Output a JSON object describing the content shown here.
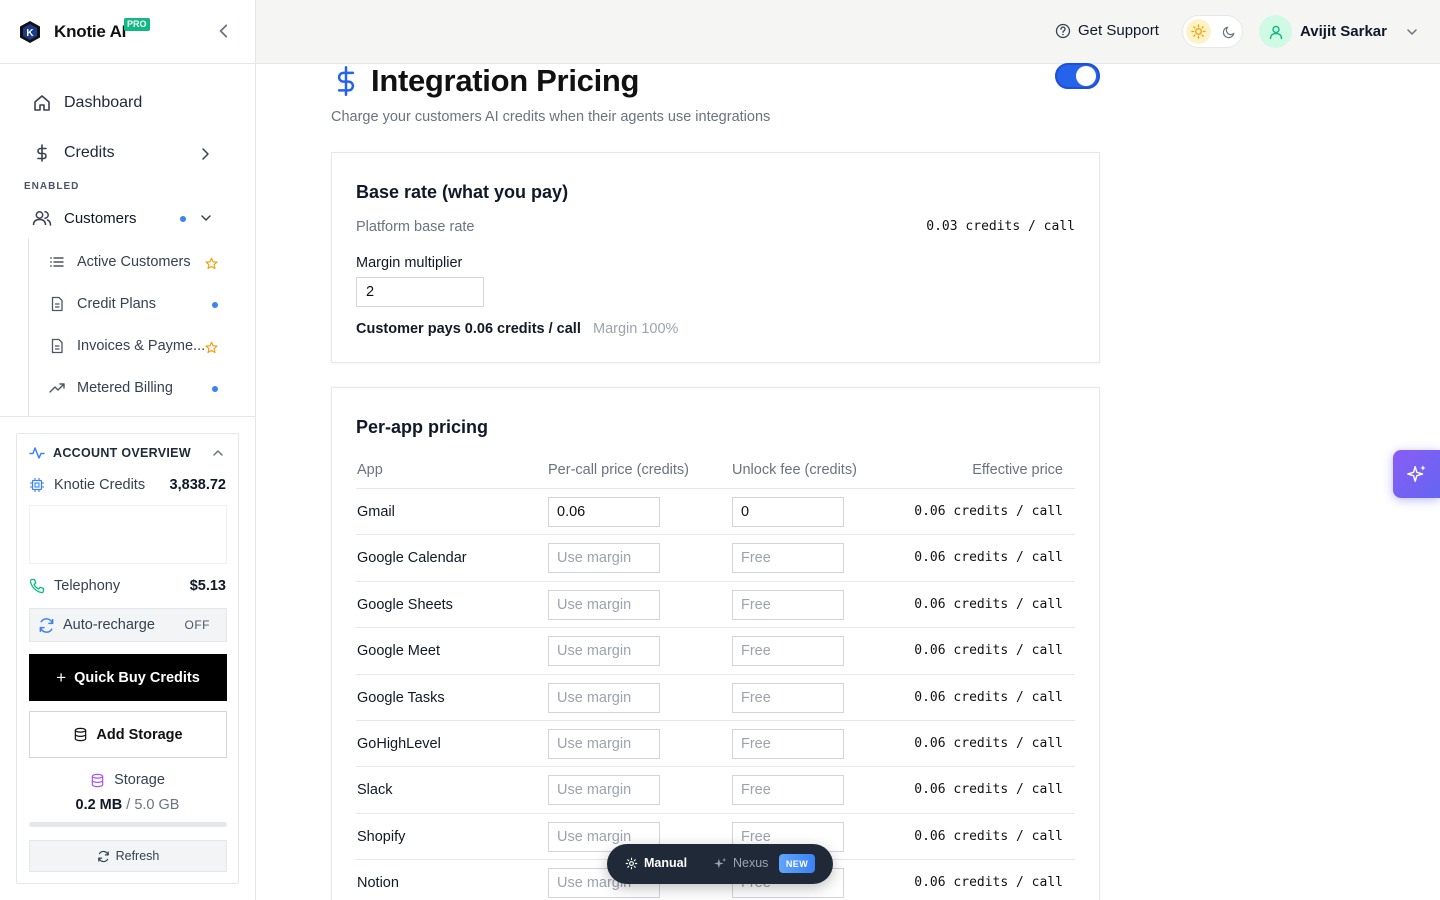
{
  "brand": {
    "name": "Knotie AI",
    "badge": "PRO"
  },
  "sidebar": {
    "nav": [
      {
        "label": "Dashboard",
        "icon": "home-icon"
      },
      {
        "label": "Credits",
        "icon": "dollar-icon"
      }
    ],
    "section_label": "ENABLED",
    "customers": {
      "label": "Customers"
    },
    "sub_items": [
      {
        "label": "Active Customers",
        "icon": "list-icon",
        "marker": "star"
      },
      {
        "label": "Credit Plans",
        "icon": "document-icon",
        "marker": "dot"
      },
      {
        "label": "Invoices & Payme...",
        "icon": "document-icon",
        "marker": "star"
      },
      {
        "label": "Metered Billing",
        "icon": "trending-icon",
        "marker": "dot"
      }
    ]
  },
  "account": {
    "title": "ACCOUNT OVERVIEW",
    "credits_label": "Knotie Credits",
    "credits_value": "3,838.72",
    "telephony_label": "Telephony",
    "telephony_value": "$5.13",
    "auto_recharge_label": "Auto-recharge",
    "auto_recharge_state": "OFF",
    "quick_buy_label": "Quick Buy Credits",
    "add_storage_label": "Add Storage",
    "storage_label": "Storage",
    "storage_used": "0.2 MB",
    "storage_total": "/ 5.0 GB",
    "storage_fraction": 4e-05,
    "refresh_label": "Refresh"
  },
  "header": {
    "support_label": "Get Support",
    "user_name": "Avijit Sarkar"
  },
  "page": {
    "title": "Integration Pricing",
    "subtitle": "Charge your customers AI credits when their agents use integrations",
    "enabled": true
  },
  "base_rate": {
    "title": "Base rate (what you pay)",
    "platform_label": "Platform base rate",
    "platform_value": "0.03 credits / call",
    "multiplier_label": "Margin multiplier",
    "multiplier_value": "2",
    "customer_pays": "Customer pays 0.06 credits / call",
    "margin": "Margin 100%"
  },
  "per_app": {
    "title": "Per-app pricing",
    "columns": [
      "App",
      "Per-call price (credits)",
      "Unlock fee (credits)",
      "Effective price"
    ],
    "rows": [
      {
        "app": "Gmail",
        "price": "0.06",
        "price_placeholder": "Use margin",
        "fee": "0",
        "fee_placeholder": "Free",
        "effective": "0.06 credits / call"
      },
      {
        "app": "Google Calendar",
        "price": "",
        "price_placeholder": "Use margin",
        "fee": "",
        "fee_placeholder": "Free",
        "effective": "0.06 credits / call"
      },
      {
        "app": "Google Sheets",
        "price": "",
        "price_placeholder": "Use margin",
        "fee": "",
        "fee_placeholder": "Free",
        "effective": "0.06 credits / call"
      },
      {
        "app": "Google Meet",
        "price": "",
        "price_placeholder": "Use margin",
        "fee": "",
        "fee_placeholder": "Free",
        "effective": "0.06 credits / call"
      },
      {
        "app": "Google Tasks",
        "price": "",
        "price_placeholder": "Use margin",
        "fee": "",
        "fee_placeholder": "Free",
        "effective": "0.06 credits / call"
      },
      {
        "app": "GoHighLevel",
        "price": "",
        "price_placeholder": "Use margin",
        "fee": "",
        "fee_placeholder": "Free",
        "effective": "0.06 credits / call"
      },
      {
        "app": "Slack",
        "price": "",
        "price_placeholder": "Use margin",
        "fee": "",
        "fee_placeholder": "Free",
        "effective": "0.06 credits / call"
      },
      {
        "app": "Shopify",
        "price": "",
        "price_placeholder": "Use margin",
        "fee": "",
        "fee_placeholder": "Free",
        "effective": "0.06 credits / call"
      },
      {
        "app": "Notion",
        "price": "",
        "price_placeholder": "Use margin",
        "fee": "",
        "fee_placeholder": "Free",
        "effective": "0.06 credits / call"
      }
    ]
  },
  "mode_switch": {
    "manual_label": "Manual",
    "nexus_label": "Nexus",
    "new_badge": "NEW"
  },
  "colors": {
    "accent": "#2563eb",
    "dot": "#3b82f6",
    "star": "#f59e0b",
    "pro": "#10b981"
  }
}
